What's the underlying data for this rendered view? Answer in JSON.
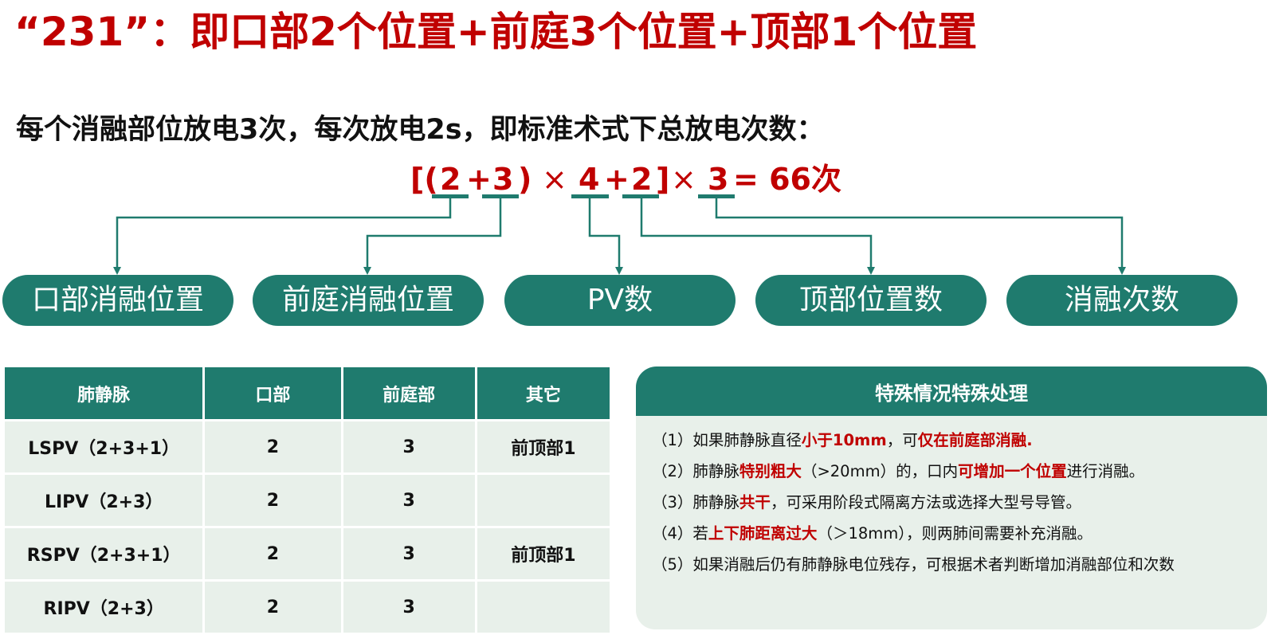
{
  "title": "“231”：即口部2个位置+前庭3个位置+顶部1个位置",
  "subtitle": "每个消融部位放电3次，每次放电2s，即标准术式下总放电次数：",
  "formula": {
    "open": "[(",
    "a": "2",
    "plus1": "+",
    "b": "3",
    "close1": ")",
    "times1": "×",
    "c": "4",
    "plus2": "+",
    "d": "2",
    "close2": "]",
    "times2": "×",
    "e": "3",
    "result": "= 66次"
  },
  "pills": [
    {
      "label": "口部消融位置"
    },
    {
      "label": "前庭消融位置"
    },
    {
      "label": "PV数"
    },
    {
      "label": "顶部位置数"
    },
    {
      "label": "消融次数"
    }
  ],
  "table": {
    "headers": [
      "肺静脉",
      "口部",
      "前庭部",
      "其它"
    ],
    "rows": [
      [
        "LSPV（2+3+1）",
        "2",
        "3",
        "前顶部1"
      ],
      [
        "LIPV（2+3）",
        "2",
        "3",
        ""
      ],
      [
        "RSPV（2+3+1）",
        "2",
        "3",
        "前顶部1"
      ],
      [
        "RIPV（2+3）",
        "2",
        "3",
        ""
      ]
    ]
  },
  "notes": {
    "heading": "特殊情况特殊处理",
    "items": [
      {
        "p1": "（1）如果肺静脉直径",
        "h1": "小于10mm",
        "p2": "，可",
        "h2": "仅在前庭部消融.",
        "p3": ""
      },
      {
        "p1": "（2）肺静脉",
        "h1": "特别粗大",
        "p2": "（>20mm）的，口内",
        "h2": "可增加一个位置",
        "p3": "进行消融。"
      },
      {
        "p1": "（3）肺静脉",
        "h1": "共干",
        "p2": "，可采用阶段式隔离方法或选择大型号导管。",
        "h2": "",
        "p3": ""
      },
      {
        "p1": "（4）若",
        "h1": "上下肺距离过大",
        "p2": "（＞18mm），则两肺间需要补充消融。",
        "h2": "",
        "p3": ""
      },
      {
        "p1": "（5）如果消融后仍有肺静脉电位残存，可根据术者判断增加消融部位和次数",
        "h1": "",
        "p2": "",
        "h2": "",
        "p3": ""
      }
    ]
  },
  "colors": {
    "accent": "#1f7b6e",
    "highlight": "#c00000",
    "panel": "#e8f0ea"
  }
}
